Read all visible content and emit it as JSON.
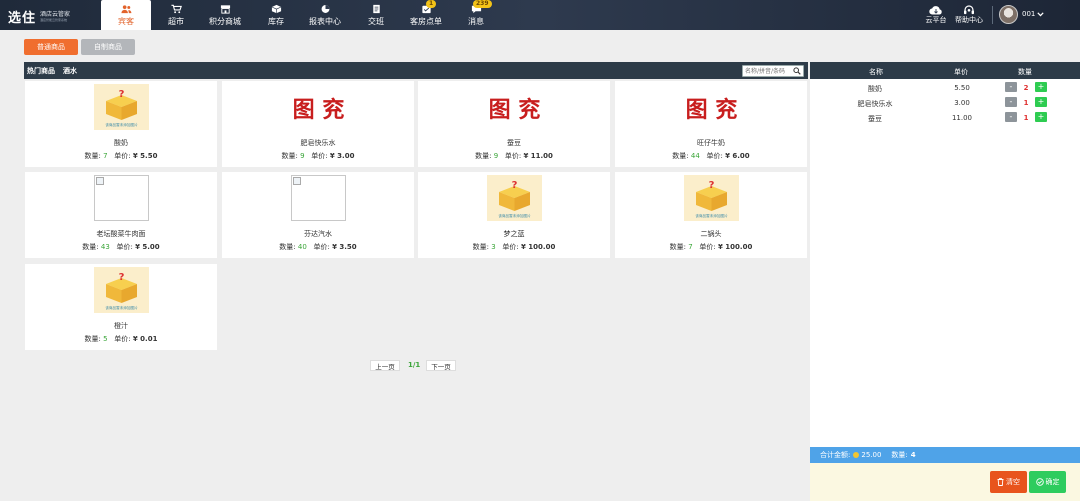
{
  "app": {
    "logo_main": "选住",
    "logo_sub": "酒店云管家",
    "logo_sub_small": "酒店智能云管家系统"
  },
  "nav": {
    "items": [
      {
        "label": "宾客",
        "icon": "people-icon",
        "active": true
      },
      {
        "label": "超市",
        "icon": "cart-icon"
      },
      {
        "label": "积分商城",
        "icon": "store-icon"
      },
      {
        "label": "库存",
        "icon": "box-icon"
      },
      {
        "label": "报表中心",
        "icon": "piechart-icon"
      },
      {
        "label": "交班",
        "icon": "document-icon"
      },
      {
        "label": "客房点单",
        "icon": "order-icon",
        "badge": "1"
      },
      {
        "label": "消息",
        "icon": "message-icon",
        "badge": "239"
      }
    ],
    "right": [
      {
        "label": "云平台",
        "icon": "cloud-icon"
      },
      {
        "label": "帮助中心",
        "icon": "headset-icon"
      }
    ],
    "user": "001"
  },
  "tabs": [
    "普通商品",
    "自制商品"
  ],
  "categories": [
    "热门商品",
    "酒水"
  ],
  "search": {
    "placeholder": "名称/拼音/条码"
  },
  "products": [
    {
      "name": "酸奶",
      "qty_label": "数量:",
      "qty": "7",
      "price_label": "单价:",
      "price": "¥ 5.50",
      "image": "placeholder-box"
    },
    {
      "name": "肥皂快乐水",
      "qty_label": "数量:",
      "qty": "9",
      "price_label": "单价:",
      "price": "¥ 3.00",
      "image": "red-handwriting"
    },
    {
      "name": "蚕豆",
      "qty_label": "数量:",
      "qty": "9",
      "price_label": "单价:",
      "price": "¥ 11.00",
      "image": "red-handwriting"
    },
    {
      "name": "旺仔牛奶",
      "qty_label": "数量:",
      "qty": "44",
      "price_label": "单价:",
      "price": "¥ 6.00",
      "image": "red-handwriting"
    },
    {
      "name": "老坛酸菜牛肉面",
      "qty_label": "数量:",
      "qty": "43",
      "price_label": "单价:",
      "price": "¥ 5.00",
      "image": "broken"
    },
    {
      "name": "芬达汽水",
      "qty_label": "数量:",
      "qty": "40",
      "price_label": "单价:",
      "price": "¥ 3.50",
      "image": "broken"
    },
    {
      "name": "梦之蓝",
      "qty_label": "数量:",
      "qty": "3",
      "price_label": "单价:",
      "price": "¥ 100.00",
      "image": "placeholder-box"
    },
    {
      "name": "二锅头",
      "qty_label": "数量:",
      "qty": "7",
      "price_label": "单价:",
      "price": "¥ 100.00",
      "image": "placeholder-box"
    },
    {
      "name": "橙汁",
      "qty_label": "数量:",
      "qty": "5",
      "price_label": "单价:",
      "price": "¥ 0.01",
      "image": "placeholder-box"
    }
  ],
  "placeholder_caption": "该商品暂未添加图片",
  "red_text": "图 兖",
  "pager": {
    "prev": "上一页",
    "page": "1/1",
    "next": "下一页"
  },
  "cart": {
    "headers": [
      "名称",
      "单价",
      "数量"
    ],
    "items": [
      {
        "name": "酸奶",
        "price": "5.50",
        "qty": "2"
      },
      {
        "name": "肥皂快乐水",
        "price": "3.00",
        "qty": "1"
      },
      {
        "name": "蚕豆",
        "price": "11.00",
        "qty": "1"
      }
    ],
    "minus": "-",
    "plus": "+",
    "total_label": "合计金额:",
    "total": "25.00",
    "count_label": "数量:",
    "count": "4",
    "clear_label": "清空",
    "confirm_label": "确定"
  },
  "colors": {
    "nav_bg": "#1f2a3a",
    "accent": "#f06e2f",
    "qty_green": "#3aa538",
    "plus_green": "#2ecc51",
    "total_blue": "#4fa3e8",
    "clear_orange": "#e8541d"
  }
}
